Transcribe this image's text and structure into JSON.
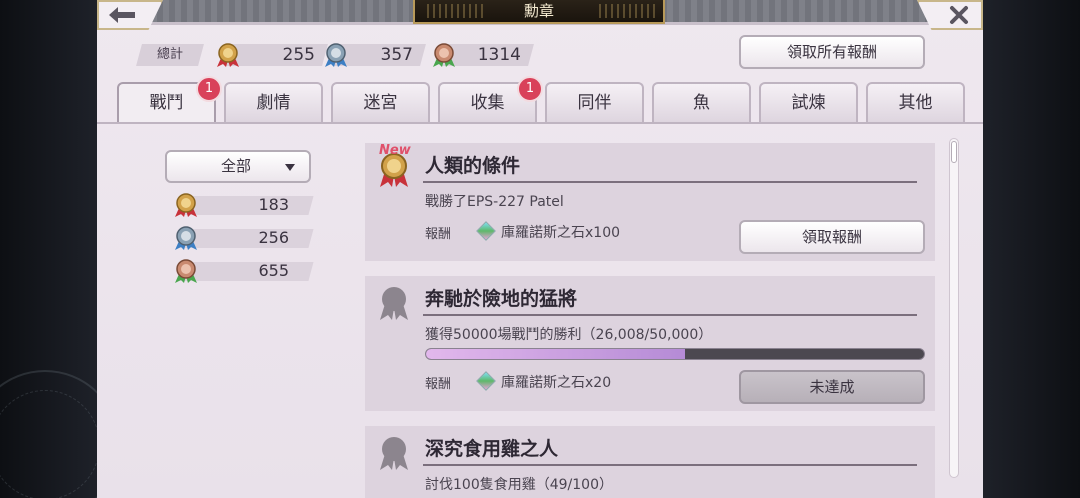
{
  "header": {
    "title": "勳章",
    "back_icon": "back-arrow-icon",
    "close_icon": "close-icon",
    "claim_all_label": "領取所有報酬"
  },
  "totals": {
    "label": "總計",
    "gold": "255",
    "silver": "357",
    "bronze": "1314"
  },
  "tabs": [
    {
      "label": "戰鬥",
      "badge": "1",
      "active": true
    },
    {
      "label": "劇情"
    },
    {
      "label": "迷宮"
    },
    {
      "label": "收集",
      "badge": "1"
    },
    {
      "label": "同伴"
    },
    {
      "label": "魚"
    },
    {
      "label": "試煉"
    },
    {
      "label": "其他"
    }
  ],
  "filter": {
    "selected": "全部",
    "counts": {
      "gold": "183",
      "silver": "256",
      "bronze": "655"
    }
  },
  "cards": [
    {
      "new_tag": "New",
      "title": "人類的條件",
      "desc": "戰勝了EPS-227 Patel",
      "reward_label": "報酬",
      "reward": "庫羅諾斯之石x100",
      "button": "領取報酬"
    },
    {
      "title": "奔馳於險地的猛將",
      "desc": "獲得50000場戰鬥的勝利（26,008/50,000）",
      "progress": 0.52,
      "reward_label": "報酬",
      "reward": "庫羅諾斯之石x20",
      "button": "未達成"
    },
    {
      "title": "深究食用雞之人",
      "desc": "討伐100隻食用雞（49/100）"
    }
  ],
  "colors": {
    "gold": "#d2a24a",
    "silver": "#8aa1b4",
    "bronze": "#c98a70",
    "ribbon_red": "#c8323a",
    "ribbon_blue": "#3d7fc4",
    "ribbon_green": "#4aa64e",
    "badge": "#d9415a"
  }
}
